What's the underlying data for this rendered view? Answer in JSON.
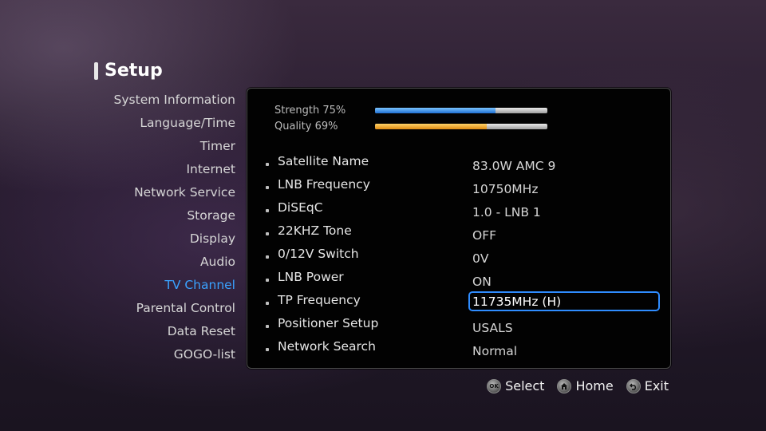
{
  "page": {
    "title": "Setup"
  },
  "menu": {
    "items": [
      {
        "label": "System Information"
      },
      {
        "label": "Language/Time"
      },
      {
        "label": "Timer"
      },
      {
        "label": "Internet"
      },
      {
        "label": "Network Service"
      },
      {
        "label": "Storage"
      },
      {
        "label": "Display"
      },
      {
        "label": "Audio"
      },
      {
        "label": "TV Channel",
        "active": true
      },
      {
        "label": "Parental Control"
      },
      {
        "label": "Data Reset"
      },
      {
        "label": "GOGO-list"
      }
    ]
  },
  "signal": {
    "strength": {
      "label": "Strength 75%",
      "level": 0.7
    },
    "quality": {
      "label": "Quality 69%",
      "level": 0.65
    }
  },
  "settings": [
    {
      "label": "Satellite Name",
      "value": "83.0W AMC 9"
    },
    {
      "label": "LNB Frequency",
      "value": "10750MHz"
    },
    {
      "label": "DiSEqC",
      "value": "1.0 - LNB 1"
    },
    {
      "label": "22KHZ Tone",
      "value": "OFF"
    },
    {
      "label": "0/12V Switch",
      "value": "0V"
    },
    {
      "label": "LNB Power",
      "value": "ON"
    },
    {
      "label": "TP Frequency",
      "value": "11735MHz (H)",
      "selected": true
    },
    {
      "label": "Positioner Setup",
      "value": "USALS"
    },
    {
      "label": "Network Search",
      "value": "Normal"
    }
  ],
  "footer": {
    "select": {
      "icon": "ok-icon",
      "icon_text": "OK",
      "label": "Select"
    },
    "home": {
      "icon": "home-icon",
      "label": "Home"
    },
    "exit": {
      "icon": "back-icon",
      "label": "Exit"
    }
  },
  "colors": {
    "accent": "#3aa2ff",
    "selection_border": "#2f8cff",
    "strength_bar": "#1f6fd2",
    "quality_bar": "#e08a10"
  }
}
